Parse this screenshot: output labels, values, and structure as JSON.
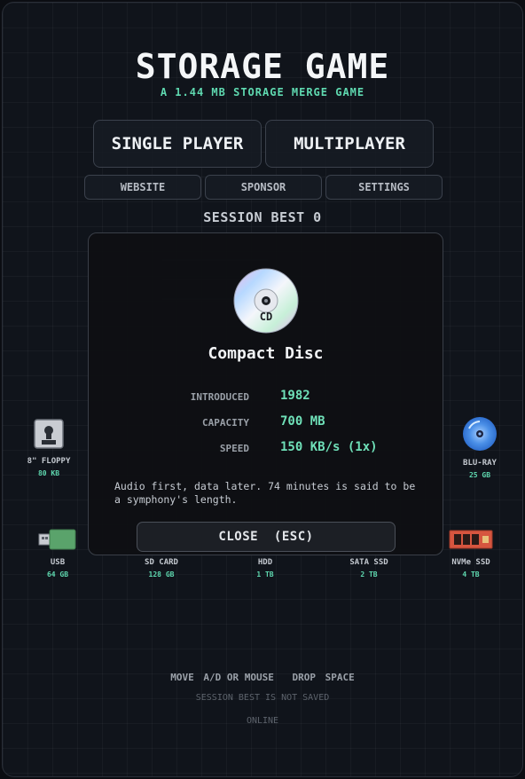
{
  "header": {
    "title": "STORAGE GAME",
    "subtitle": "A 1.44 MB STORAGE MERGE GAME"
  },
  "menu": {
    "single_player": "SINGLE PLAYER",
    "multiplayer": "MULTIPLAYER",
    "website": "WEBSITE",
    "sponsor": "SPONSOR",
    "settings": "SETTINGS"
  },
  "session_best": "SESSION BEST 0",
  "tiers": [
    {
      "name": "8\" FLOPPY",
      "capacity": "80 KB",
      "icon": "floppy-icon",
      "color": "#c9ccd2"
    },
    {
      "name": "BLU-RAY",
      "capacity": "25 GB",
      "icon": "bluray-icon",
      "color": "#4a8fe7"
    },
    {
      "name": "USB",
      "capacity": "64 GB",
      "icon": "usb-icon",
      "color": "#5aa36b"
    },
    {
      "name": "SD CARD",
      "capacity": "128 GB",
      "icon": "sdcard-icon",
      "color": "#d9a23a"
    },
    {
      "name": "HDD",
      "capacity": "1 TB",
      "icon": "hdd-icon",
      "color": "#8a8f97"
    },
    {
      "name": "SATA SSD",
      "capacity": "2 TB",
      "icon": "sata-ssd-icon",
      "color": "#3d4450"
    },
    {
      "name": "NVMe SSD",
      "capacity": "4 TB",
      "icon": "nvme-ssd-icon",
      "color": "#d6553f"
    }
  ],
  "modal": {
    "icon_label": "CD",
    "title": "Compact Disc",
    "introduced_label": "INTRODUCED",
    "introduced": "1982",
    "capacity_label": "CAPACITY",
    "capacity": "700 MB",
    "speed_label": "SPEED",
    "speed": "150 KB/s (1x)",
    "description": "Audio first, data later. 74 minutes is said to be a symphony's length.",
    "close": "CLOSE  (ESC)"
  },
  "footer": {
    "move_label": "MOVE",
    "move_keys": "A/D OR MOUSE",
    "drop_label": "DROP",
    "drop_key": "SPACE",
    "note": "SESSION BEST IS NOT SAVED",
    "status": "ONLINE"
  },
  "colors": {
    "accent": "#5fd9b0",
    "background": "#10141b"
  }
}
